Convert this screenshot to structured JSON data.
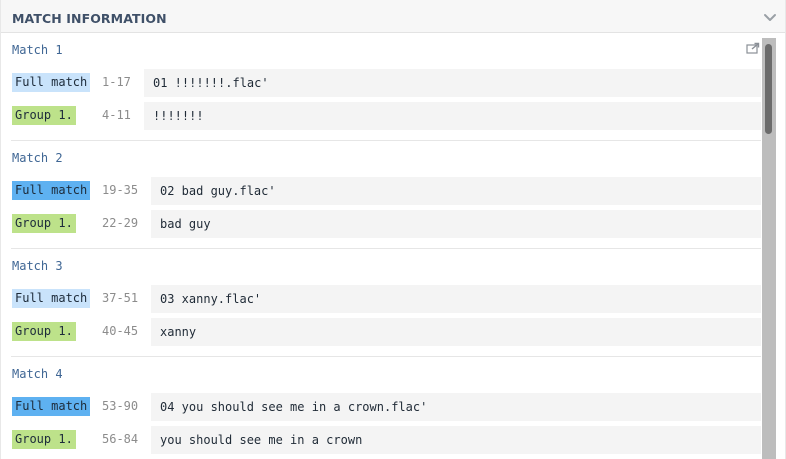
{
  "header": {
    "title": "MATCH INFORMATION",
    "collapse_icon": "chevron-down-icon"
  },
  "share_icon": "share-icon",
  "matches": [
    {
      "title": "Match 1",
      "full": {
        "tag": "Full match",
        "range": "1-17",
        "value": "01 !!!!!!!.flac'"
      },
      "group": {
        "tag": "Group 1.",
        "range": "4-11",
        "value": "!!!!!!!"
      }
    },
    {
      "title": "Match 2",
      "full": {
        "tag": "Full match",
        "range": "19-35",
        "value": "02 bad guy.flac'"
      },
      "group": {
        "tag": "Group 1.",
        "range": "22-29",
        "value": "bad guy"
      }
    },
    {
      "title": "Match 3",
      "full": {
        "tag": "Full match",
        "range": "37-51",
        "value": "03 xanny.flac'"
      },
      "group": {
        "tag": "Group 1.",
        "range": "40-45",
        "value": "xanny"
      }
    },
    {
      "title": "Match 4",
      "full": {
        "tag": "Full match",
        "range": "53-90",
        "value": "04 you should see me in a crown.flac'"
      },
      "group": {
        "tag": "Group 1.",
        "range": "56-84",
        "value": "you should see me in a crown"
      }
    }
  ],
  "colors": {
    "full_match_light": "#c9e3fb",
    "full_match_dark": "#5eb1f1",
    "group": "#bde28a",
    "match_title": "#3f6694"
  }
}
